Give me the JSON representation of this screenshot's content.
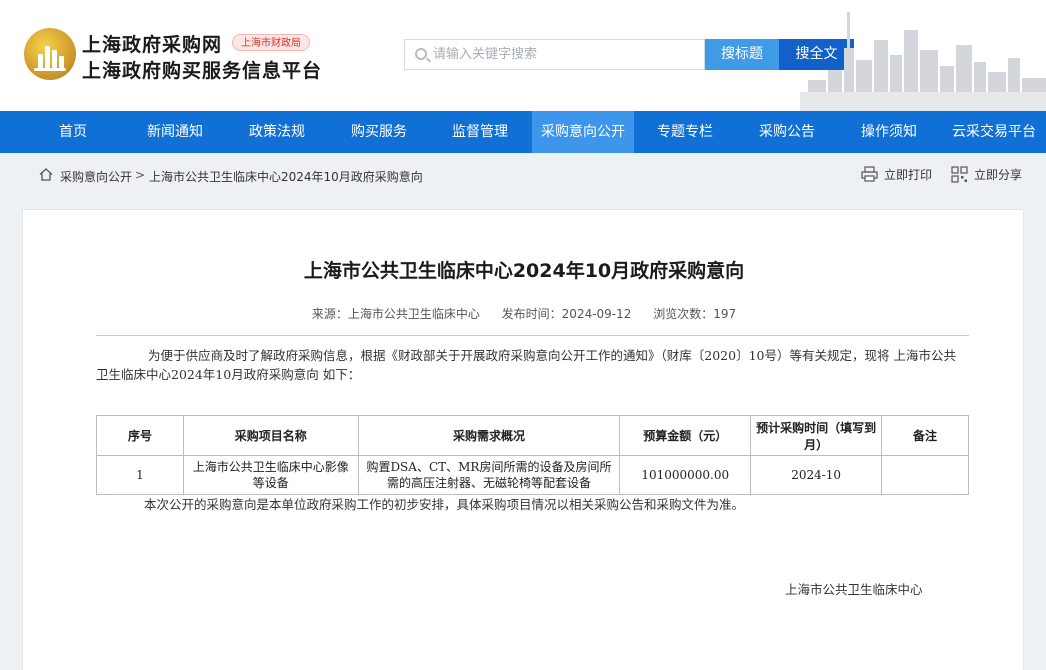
{
  "header": {
    "title_line1": "上海政府采购网",
    "title_line2": "上海政府购买服务信息平台",
    "badge": "上海市财政局",
    "search_placeholder": "请输入关键字搜索",
    "search_title_button": "搜标题",
    "search_full_button": "搜全文"
  },
  "nav": {
    "items": [
      "首页",
      "新闻通知",
      "政策法规",
      "购买服务",
      "监督管理",
      "采购意向公开",
      "专题专栏",
      "采购公告",
      "操作须知",
      "云采交易平台"
    ],
    "active": "采购意向公开"
  },
  "breadcrumb": {
    "section": "采购意向公开",
    "separator": ">",
    "current": "上海市公共卫生临床中心2024年10月政府采购意向"
  },
  "tools": {
    "print": "立即打印",
    "share": "立即分享"
  },
  "article": {
    "title": "上海市公共卫生临床中心2024年10月政府采购意向",
    "source": "来源：上海市公共卫生临床中心",
    "published": "发布时间：2024-09-12",
    "views": "浏览次数：197",
    "intro": "为便于供应商及时了解政府采购信息，根据《财政部关于开展政府采购意向公开工作的通知》（财库〔2020〕10号）等有关规定，现将 上海市公共卫生临床中心2024年10月政府采购意向 如下：",
    "table": {
      "headers": [
        "序号",
        "采购项目名称",
        "采购需求概况",
        "预算金额（元）",
        "预计采购时间（填写到月）",
        "备注"
      ],
      "rows": [
        [
          "1",
          "上海市公共卫生临床中心影像等设备",
          "购置DSA、CT、MR房间所需的设备及房间所需的高压注射器、无磁轮椅等配套设备",
          "101000000.00",
          "2024-10",
          ""
        ]
      ]
    },
    "note": "本次公开的采购意向是本单位政府采购工作的初步安排，具体采购项目情况以相关采购公告和采购文件为准。",
    "signature": "上海市公共卫生临床中心"
  },
  "colors": {
    "nav_bg": "#1070d6",
    "nav_active": "#3d96ec",
    "search_title_btn": "#3f9be6",
    "search_full_btn": "#1260c9",
    "badge_text": "#d4322c"
  },
  "icons": {
    "logo": "gold-emblem-logo",
    "search": "search-icon",
    "home": "home-icon",
    "print": "printer-icon",
    "share": "qr-share-icon"
  }
}
